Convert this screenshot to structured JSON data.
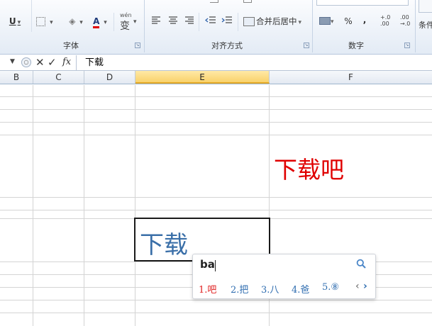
{
  "ribbon": {
    "font_group": {
      "label": "字体",
      "underline": "U",
      "font_color": "A",
      "phonetic": "wén",
      "phonetic_char": "变"
    },
    "align_group": {
      "label": "对齐方式",
      "merge_center": "合并后居中"
    },
    "number_group": {
      "label": "数字",
      "percent": "%",
      "comma": ",",
      "inc_decimal": "+.0\n.00",
      "dec_decimal": ".00\n→.0"
    },
    "styles_group": {
      "conditional": "条件"
    }
  },
  "formula_bar": {
    "cancel": "✕",
    "enter": "✓",
    "fx": "fx",
    "value": "下载"
  },
  "columns": [
    {
      "label": "B"
    },
    {
      "label": "C"
    },
    {
      "label": "D"
    },
    {
      "label": "E",
      "selected": true
    },
    {
      "label": "F"
    }
  ],
  "cells": {
    "f_cell_text": "下载吧",
    "f_cell_color": "#e00000",
    "e_active_text": "下载",
    "e_active_color": "#3a6fa8"
  },
  "ime": {
    "input": "ba",
    "candidates": [
      "1.吧",
      "2.把",
      "3.八",
      "4.爸",
      "5.⑧"
    ],
    "prev": "‹",
    "next": "›",
    "search_icon": "search-icon"
  }
}
